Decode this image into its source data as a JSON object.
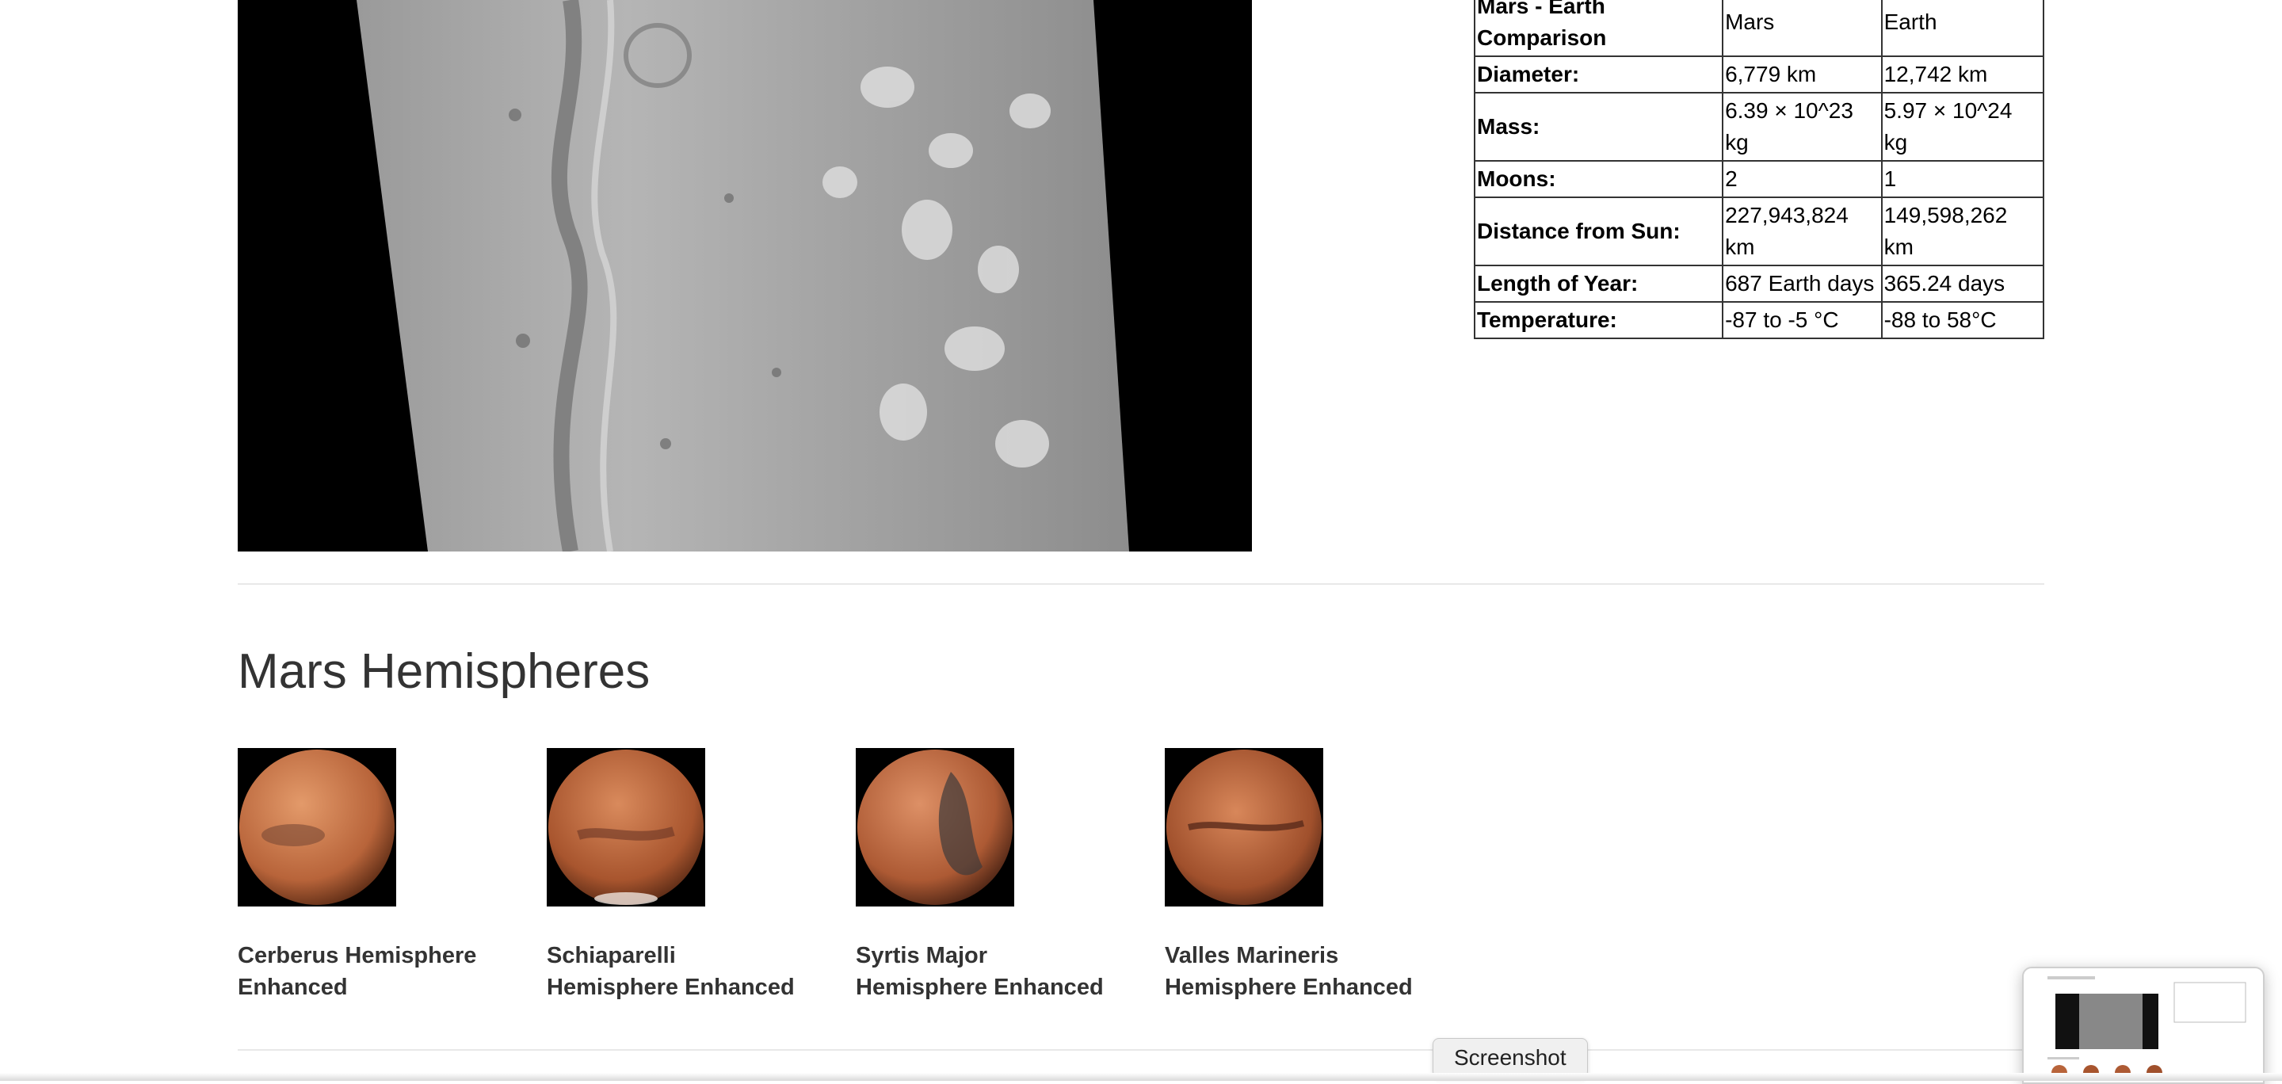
{
  "facts_table": {
    "header": {
      "label": "Mars - Earth Comparison",
      "col1": "Mars",
      "col2": "Earth"
    },
    "rows": [
      {
        "label": "Diameter:",
        "mars": "6,779 km",
        "earth": "12,742 km"
      },
      {
        "label": "Mass:",
        "mars": "6.39 × 10^23 kg",
        "earth": "5.97 × 10^24 kg"
      },
      {
        "label": "Moons:",
        "mars": "2",
        "earth": "1"
      },
      {
        "label": "Distance from Sun:",
        "mars": "227,943,824 km",
        "earth": "149,598,262 km"
      },
      {
        "label": "Length of Year:",
        "mars": "687 Earth days",
        "earth": "365.24 days"
      },
      {
        "label": "Temperature:",
        "mars": "-87 to -5 °C",
        "earth": "-88 to 58°C"
      }
    ]
  },
  "hemispheres": {
    "title": "Mars Hemispheres",
    "items": [
      {
        "caption": "Cerberus Hemisphere Enhanced"
      },
      {
        "caption": "Schiaparelli Hemisphere Enhanced"
      },
      {
        "caption": "Syrtis Major Hemisphere Enhanced"
      },
      {
        "caption": "Valles Marineris Hemisphere Enhanced"
      }
    ]
  },
  "screenshot_tooltip": "Screenshot",
  "colors": {
    "planet": "#c06a3c",
    "terrain": "#8e8e8e"
  }
}
